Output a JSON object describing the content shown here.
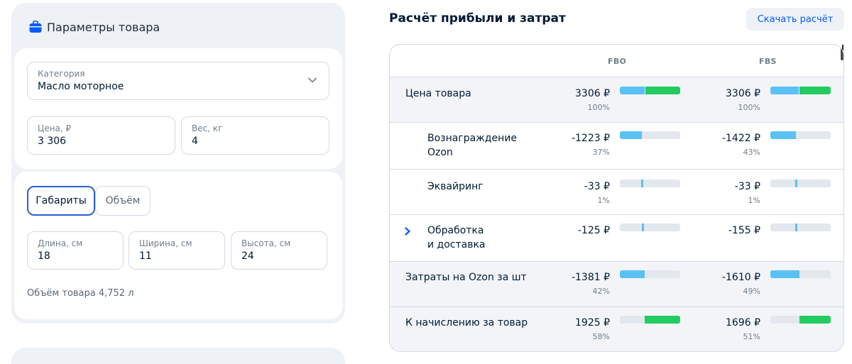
{
  "left": {
    "title": "Параметры товара",
    "category": {
      "label": "Категория",
      "value": "Масло моторное"
    },
    "price": {
      "label": "Цена, ₽",
      "value": "3 306"
    },
    "weight": {
      "label": "Вес, кг",
      "value": "4"
    },
    "tabs": [
      {
        "label": "Габариты",
        "active": true
      },
      {
        "label": "Объём",
        "active": false
      }
    ],
    "length": {
      "label": "Длина, см",
      "value": "18"
    },
    "width": {
      "label": "Ширина, см",
      "value": "11"
    },
    "height": {
      "label": "Высота, см",
      "value": "24"
    },
    "volume_text": "Объём товара 4,752 л"
  },
  "right": {
    "title": "Расчёт прибыли и затрат",
    "download_label": "Скачать расчёт",
    "columns": [
      "FBO",
      "FBS"
    ],
    "rows": [
      {
        "label": "Цена товара",
        "fbo_amount": "3306 ₽",
        "fbo_pct": "100%",
        "fbs_amount": "3306 ₽",
        "fbs_pct": "100%"
      },
      {
        "label": "Вознаграждение Ozon",
        "fbo_amount": "-1223 ₽",
        "fbo_pct": "37%",
        "fbs_amount": "-1422 ₽",
        "fbs_pct": "43%"
      },
      {
        "label": "Эквайринг",
        "fbo_amount": "-33 ₽",
        "fbo_pct": "1%",
        "fbs_amount": "-33 ₽",
        "fbs_pct": "1%"
      },
      {
        "label_line1": "Обработка",
        "label_line2": "и доставка",
        "fbo_amount": "-125 ₽",
        "fbs_amount": "-155 ₽"
      },
      {
        "label": "Затраты на Ozon за шт",
        "fbo_amount": "-1381 ₽",
        "fbo_pct": "42%",
        "fbs_amount": "-1610 ₽",
        "fbs_pct": "49%"
      },
      {
        "label": "К начислению за товар",
        "fbo_amount": "1925 ₽",
        "fbo_pct": "58%",
        "fbs_amount": "1696 ₽",
        "fbs_pct": "51%"
      }
    ]
  },
  "colors": {
    "accent": "#005bff",
    "bar_blue": "#5ac1f5",
    "bar_green": "#22cc60",
    "bar_track": "#e3e7ee"
  },
  "icons": {
    "title_icon": "shopping-bag-icon",
    "select_icon": "chevron-down-icon",
    "expand_icon": "chevron-right-icon"
  }
}
